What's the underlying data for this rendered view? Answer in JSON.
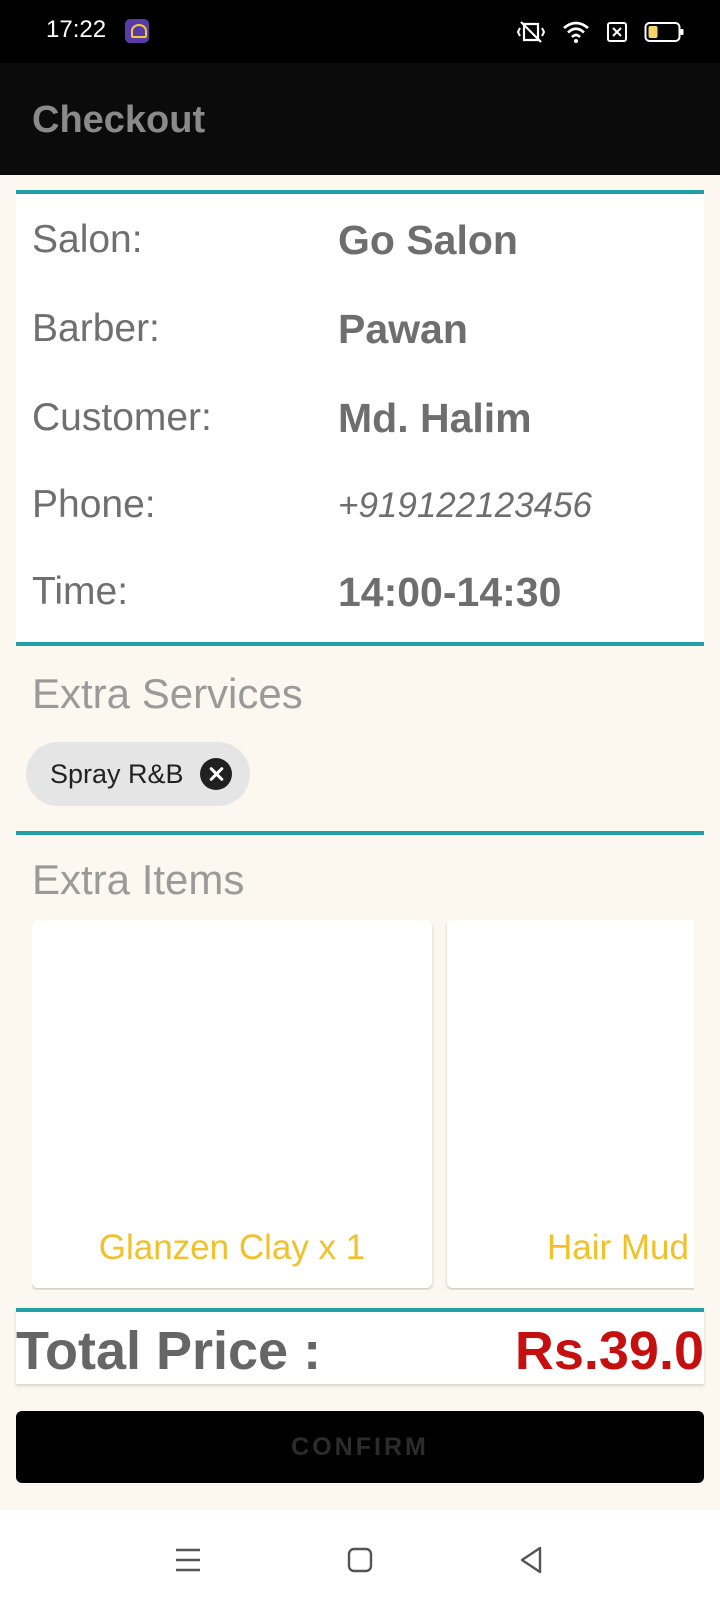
{
  "status_bar": {
    "time": "17:22",
    "icons": [
      "app-notification-icon",
      "vibrate-icon",
      "wifi-icon",
      "sim-icon",
      "battery-icon"
    ]
  },
  "app_bar": {
    "title": "Checkout"
  },
  "booking": {
    "rows": [
      {
        "label": "Salon:",
        "value": "Go Salon"
      },
      {
        "label": "Barber:",
        "value": "Pawan"
      },
      {
        "label": "Customer:",
        "value": "Md. Halim"
      },
      {
        "label": "Phone:",
        "value": "+919122123456"
      },
      {
        "label": "Time:",
        "value": "14:00-14:30"
      }
    ]
  },
  "extra_services": {
    "title": "Extra Services",
    "chips": [
      {
        "label": "Spray R&B"
      }
    ]
  },
  "extra_items": {
    "title": "Extra Items",
    "items": [
      {
        "name": "Glanzen Clay x 1"
      },
      {
        "name": "Hair Mud"
      }
    ]
  },
  "total": {
    "label": "Total Price :",
    "value": "Rs.39.0"
  },
  "confirm": {
    "label": "CONFIRM"
  },
  "colors": {
    "accent": "#22a0a8",
    "price": "#c61010",
    "item_name": "#f2c12a",
    "background": "#fcf8ef"
  },
  "nav_bar": {
    "icons": [
      "menu-icon",
      "home-icon",
      "back-icon"
    ]
  }
}
